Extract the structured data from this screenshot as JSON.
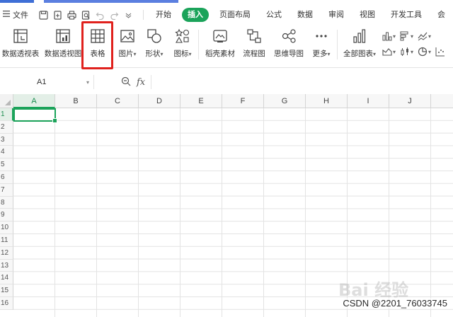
{
  "menu": {
    "file_label": "文件",
    "tabs": [
      "开始",
      "插入",
      "页面布局",
      "公式",
      "数据",
      "审阅",
      "视图",
      "开发工具",
      "会"
    ],
    "active_tab": "插入"
  },
  "ribbon": {
    "buttons": [
      {
        "label": "数据透视表",
        "icon": "pivot-table-icon"
      },
      {
        "label": "数据透视图",
        "icon": "pivot-chart-icon"
      },
      {
        "label": "表格",
        "icon": "table-icon"
      },
      {
        "label": "图片",
        "icon": "picture-icon"
      },
      {
        "label": "形状",
        "icon": "shapes-icon"
      },
      {
        "label": "图标",
        "icon": "icons-icon"
      },
      {
        "label": "稻壳素材",
        "icon": "material-icon"
      },
      {
        "label": "流程图",
        "icon": "flowchart-icon"
      },
      {
        "label": "思维导图",
        "icon": "mindmap-icon"
      },
      {
        "label": "更多",
        "icon": "more-icon"
      },
      {
        "label": "全部图表",
        "icon": "all-charts-icon"
      }
    ],
    "highlighted": "表格"
  },
  "formula_bar": {
    "cell_ref": "A1",
    "fx_label": "fx",
    "formula_value": ""
  },
  "grid": {
    "columns": [
      "A",
      "B",
      "C",
      "D",
      "E",
      "F",
      "G",
      "H",
      "I",
      "J"
    ],
    "rows": [
      "1",
      "2",
      "3",
      "4",
      "5",
      "6",
      "7",
      "8",
      "9",
      "10",
      "11",
      "12",
      "13",
      "14",
      "15",
      "16"
    ],
    "active_column": "A",
    "active_row": "1"
  },
  "credit": "CSDN @2201_76033745",
  "colors": {
    "accent": "#1ba35a",
    "highlight": "#e0211d"
  }
}
